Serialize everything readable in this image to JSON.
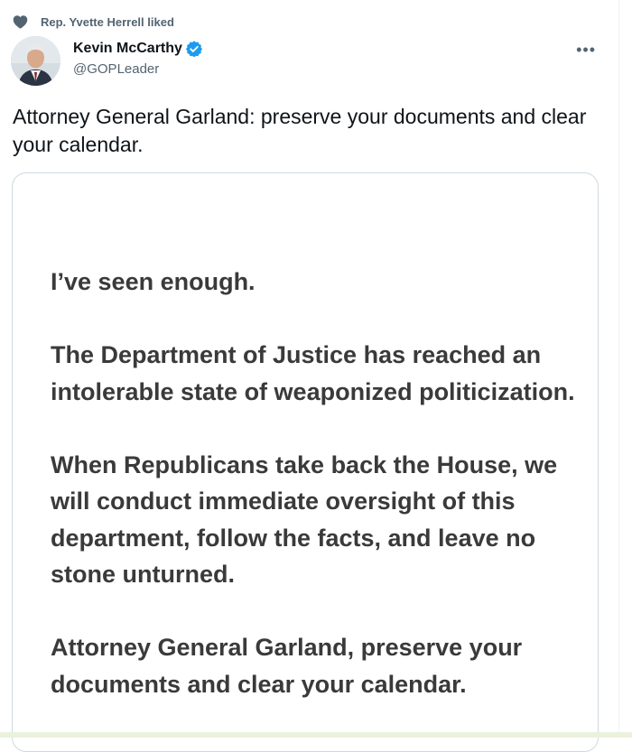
{
  "social_context": {
    "text": "Rep. Yvette Herrell liked"
  },
  "tweet": {
    "author": {
      "display_name": "Kevin McCarthy",
      "handle": "@GOPLeader",
      "verified": true
    },
    "more_label": "•••",
    "text": "Attorney General Garland: preserve your documents and clear your calendar."
  },
  "media": {
    "statement_paragraphs": [
      "I’ve seen enough.",
      "The Department of Justice has reached an intolerable state of weaponized politicization.",
      "When Republicans take back the House, we will conduct immediate oversight of this department, follow the facts, and leave no stone unturned.",
      "Attorney General Garland, preserve your documents and clear your calendar."
    ]
  },
  "colors": {
    "verified": "#1d9bf0",
    "secondary_text": "#536471",
    "statement_text": "#3a3a3a"
  }
}
